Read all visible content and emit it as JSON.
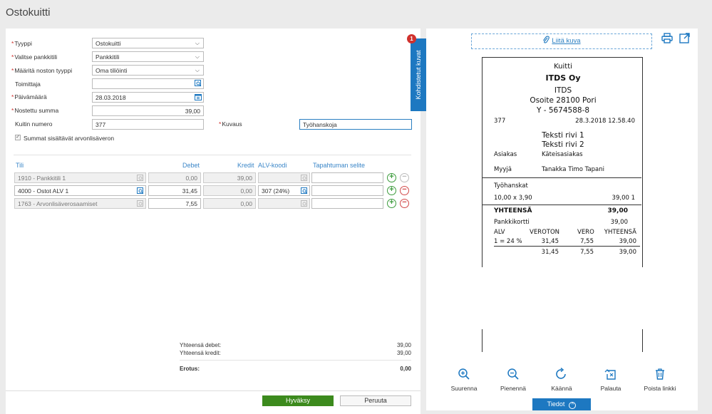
{
  "page_title": "Ostokuitti",
  "form": {
    "tyyppi": {
      "label": "Tyyppi",
      "value": "Ostokuitti"
    },
    "pankkitili": {
      "label": "Valitse pankkitili",
      "value": "Pankkitili"
    },
    "noston_tyyppi": {
      "label": "Määritä noston tyyppi",
      "value": "Oma tiliöinti"
    },
    "toimittaja": {
      "label": "Toimittaja",
      "value": ""
    },
    "paivamaara": {
      "label": "Päivämäärä",
      "value": "28.03.2018"
    },
    "nostettu_summa": {
      "label": "Nostettu summa",
      "value": "39,00"
    },
    "kuitin_numero": {
      "label": "Kuitin numero",
      "value": "377"
    },
    "kuvaus": {
      "label": "Kuvaus",
      "value": "Työhanskoja"
    },
    "alv_checkbox": {
      "label": "Summat sisältävät arvonlisäveron",
      "checked": true
    }
  },
  "table": {
    "headers": {
      "tili": "Tili",
      "debet": "Debet",
      "kredit": "Kredit",
      "alv": "ALV-koodi",
      "selite": "Tapahtuman selite"
    },
    "rows": [
      {
        "tili": "1910 - Pankkitili 1",
        "debet": "0,00",
        "kredit": "39,00",
        "alv": "",
        "selite": "",
        "disabled": true
      },
      {
        "tili": "4000 - Ostot ALV 1",
        "debet": "31,45",
        "kredit": "0,00",
        "alv": "307 (24%)",
        "selite": "",
        "disabled": false
      },
      {
        "tili": "1763 - Arvonlisäverosaamiset",
        "debet": "7,55",
        "kredit": "0,00",
        "alv": "",
        "selite": "",
        "disabled": true
      }
    ]
  },
  "totals": {
    "debet_label": "Yhteensä debet:",
    "debet_value": "39,00",
    "kredit_label": "Yhteensä kredit:",
    "kredit_value": "39,00",
    "erotus_label": "Erotus:",
    "erotus_value": "0,00"
  },
  "buttons": {
    "accept": "Hyväksy",
    "cancel": "Peruuta"
  },
  "side_tab": {
    "label": "Kohdistetut kuvat",
    "badge": "1"
  },
  "attach_label": "Liitä kuva",
  "receipt": {
    "title": "Kuitti",
    "company": "ITDS Oy",
    "line1": "ITDS",
    "address": "Osoite 28100 Pori",
    "ytunnus": "Y - 5674588-8",
    "number": "377",
    "datetime": "28.3.2018 12.58.40",
    "text1": "Teksti rivi 1",
    "text2": "Teksti rivi 2",
    "customer_label": "Asiakas",
    "customer_value": "Käteisasiakas",
    "seller_label": "Myyjä",
    "seller_value": "Tanakka Timo Tapani",
    "item_name": "Työhanskat",
    "item_qty": "10,00 x 3,90",
    "item_total": "39,00 1",
    "total_label": "YHTEENSÄ",
    "total_value": "39,00",
    "payment_label": "Pankkikortti",
    "payment_value": "39,00",
    "vat_headers": [
      "ALV",
      "VEROTON",
      "VERO",
      "YHTEENSÄ"
    ],
    "vat_row": [
      "1 = 24 %",
      "31,45",
      "7,55",
      "39,00"
    ],
    "vat_sum": [
      "31,45",
      "7,55",
      "39,00"
    ]
  },
  "tools": {
    "zoom_in": "Suurenna",
    "zoom_out": "Pienennä",
    "rotate": "Käännä",
    "restore": "Palauta",
    "remove_link": "Poista linkki"
  },
  "tiedot": "Tiedot"
}
